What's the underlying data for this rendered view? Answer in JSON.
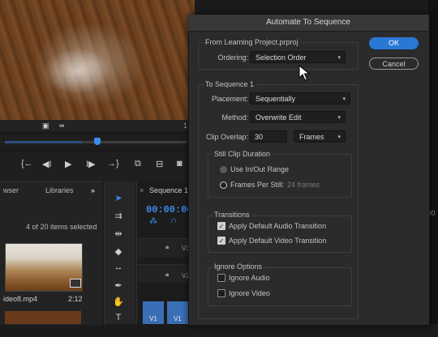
{
  "background": {
    "transport_icons": [
      "{←",
      "◀I",
      "▶",
      "I▶",
      "→}"
    ],
    "project_tabs": [
      "wser",
      "Libraries",
      "»"
    ],
    "items_selected": "4 of 20 items selected",
    "thumbnail": {
      "name": "ideo8.mp4",
      "duration": "2:12"
    },
    "sequence_tab": "Sequence 1",
    "timecode": "00:00:00:",
    "tracks": [
      "V3",
      "V2",
      "V1"
    ],
    "clip_label": "V1",
    "right_timecode": ":00",
    "accent_color": "#3d8cf0"
  },
  "dialog": {
    "title": "Automate To Sequence",
    "ok_label": "OK",
    "cancel_label": "Cancel",
    "from_label": "From Learning Project.prproj",
    "ordering_label": "Ordering:",
    "ordering_value": "Selection Order",
    "to_label": "To Sequence 1",
    "placement_label": "Placement:",
    "placement_value": "Sequentially",
    "method_label": "Method:",
    "method_value": "Overwrite Edit",
    "clip_overlap_label": "Clip Overlap:",
    "clip_overlap_value": "30",
    "clip_overlap_unit": "Frames",
    "still_clip_label": "Still Clip Duration",
    "use_in_out_label": "Use In/Out Range",
    "frames_per_still_label": "Frames Per Still:",
    "frames_per_still_value": "24 frames",
    "transitions_label": "Transitions",
    "audio_transition_label": "Apply Default Audio Transition",
    "video_transition_label": "Apply Default Video Transition",
    "ignore_options_label": "Ignore Options",
    "ignore_audio_label": "Ignore Audio",
    "ignore_video_label": "Ignore Video",
    "ok_color": "#2a77d6"
  }
}
